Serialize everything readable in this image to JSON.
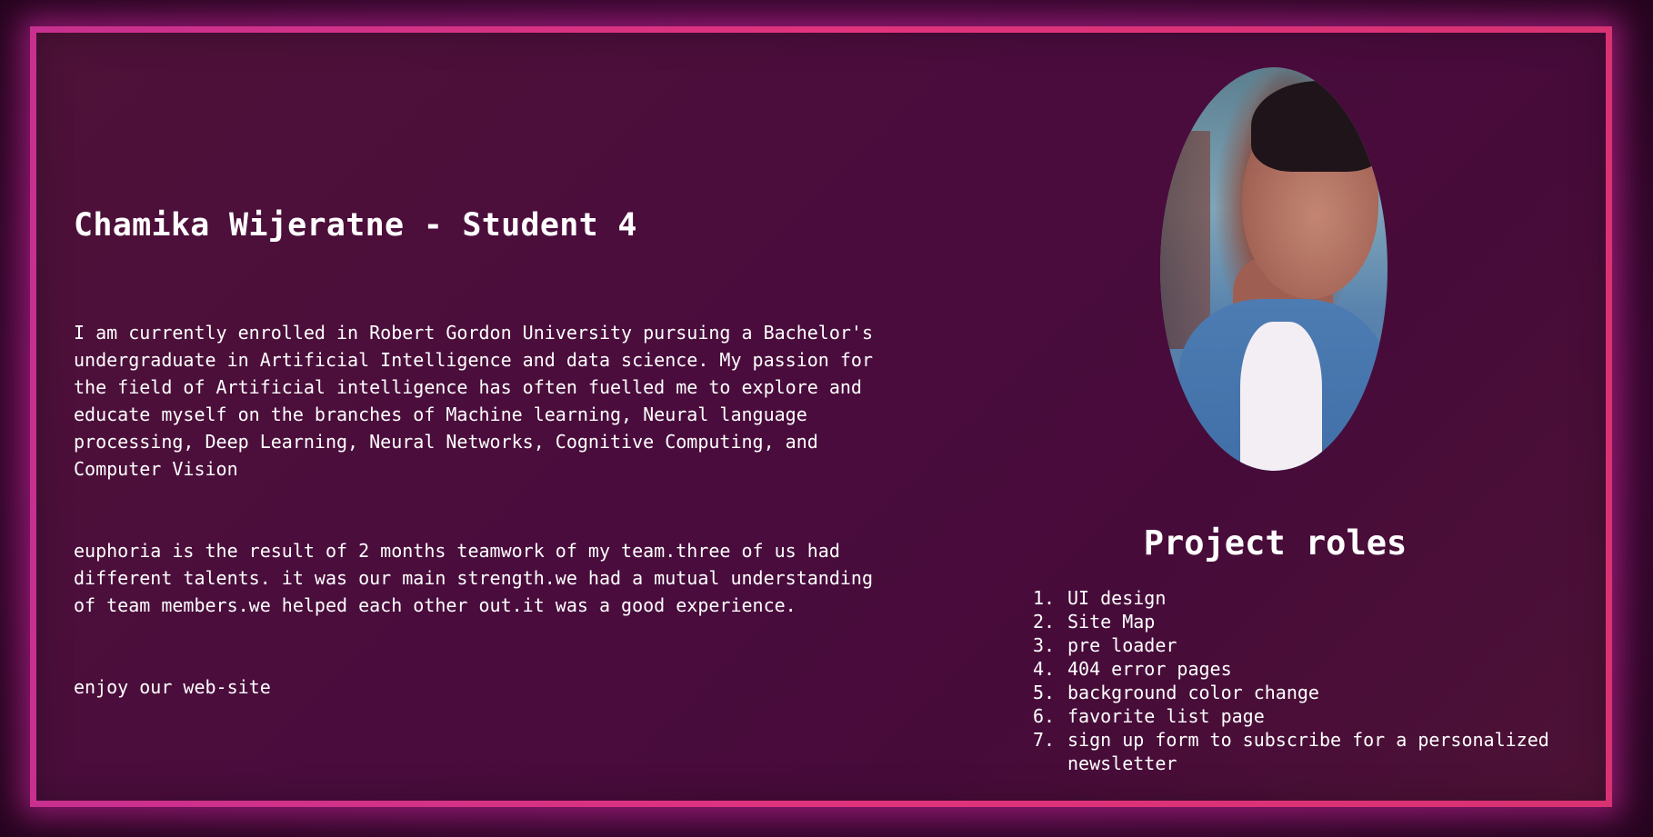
{
  "student": {
    "name": "Chamika Wijeratne - Student 4",
    "bio_paragraphs": [
      "I am currently enrolled in Robert Gordon University pursuing a Bachelor's undergraduate in Artificial Intelligence and data science. My passion for the field of Artificial intelligence has often fuelled me to explore and educate myself on the branches of Machine learning, Neural language processing, Deep Learning, Neural Networks, Cognitive Computing, and Computer Vision",
      "euphoria is the result of 2 months teamwork of my team.three of us had different talents. it was our main strength.we had a mutual understanding of team members.we helped each other out.it was a good experience.",
      "enjoy our web-site"
    ]
  },
  "roles": {
    "title": "Project roles",
    "items": [
      "UI design",
      "Site Map",
      "pre loader",
      "404 error pages",
      "background color change",
      "favorite list page",
      "sign up form to subscribe for a personalized newsletter"
    ],
    "numbers": [
      "1.",
      "2.",
      "3.",
      "4.",
      "5.",
      "6.",
      "7."
    ]
  },
  "colors": {
    "border": "#d93388",
    "card_background": "#4a0c3d",
    "page_background": "#2a0628",
    "text": "#ffffff"
  }
}
